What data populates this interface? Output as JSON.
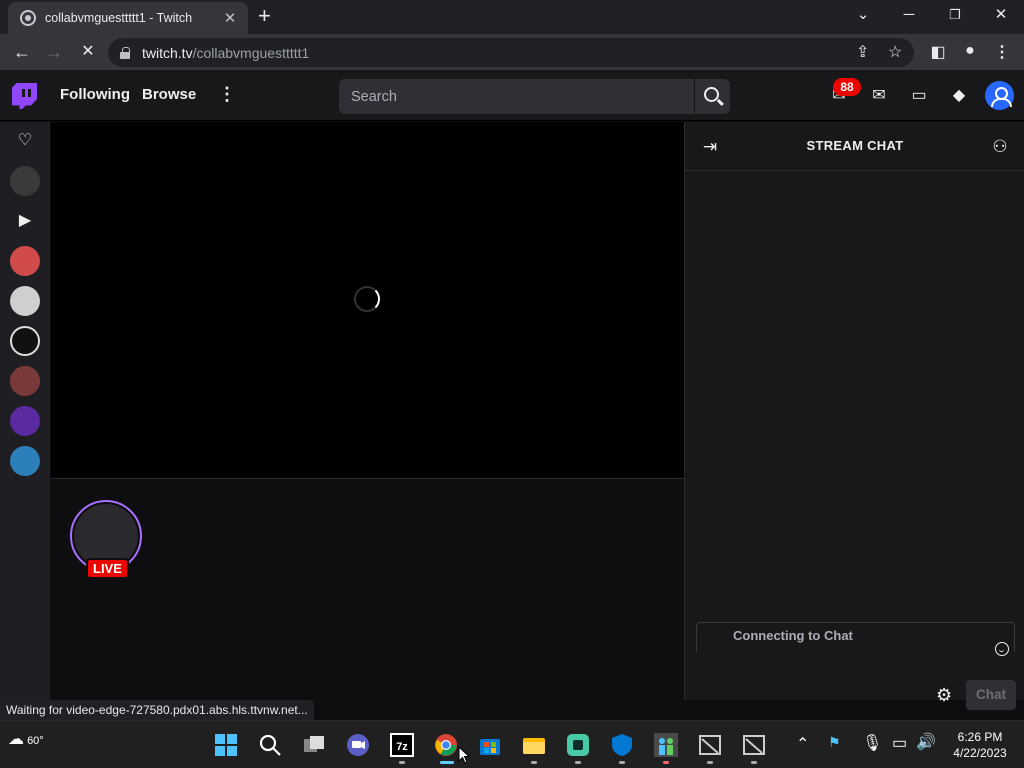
{
  "browser": {
    "tab_title": "collabvmguesttttt1 - Twitch",
    "new_tab": "+",
    "url_host": "twitch.tv",
    "url_path": "/collabvmguesttttt1",
    "status_text": "Waiting for video-edge-727580.pdx01.abs.hls.ttvnw.net..."
  },
  "twitch_nav": {
    "following": "Following",
    "browse": "Browse",
    "search_placeholder": "Search",
    "notif_count": "88"
  },
  "stream": {
    "live_label": "LIVE"
  },
  "chat": {
    "title": "STREAM CHAT",
    "connecting": "Connecting to Chat",
    "send_label": "Chat"
  },
  "taskbar": {
    "temperature": "60°",
    "time": "6:26 PM",
    "date": "4/22/2023"
  },
  "colors": {
    "twitch_purple": "#9147ff",
    "live_red": "#eb0400",
    "avatar_blue": "#2968ff"
  }
}
